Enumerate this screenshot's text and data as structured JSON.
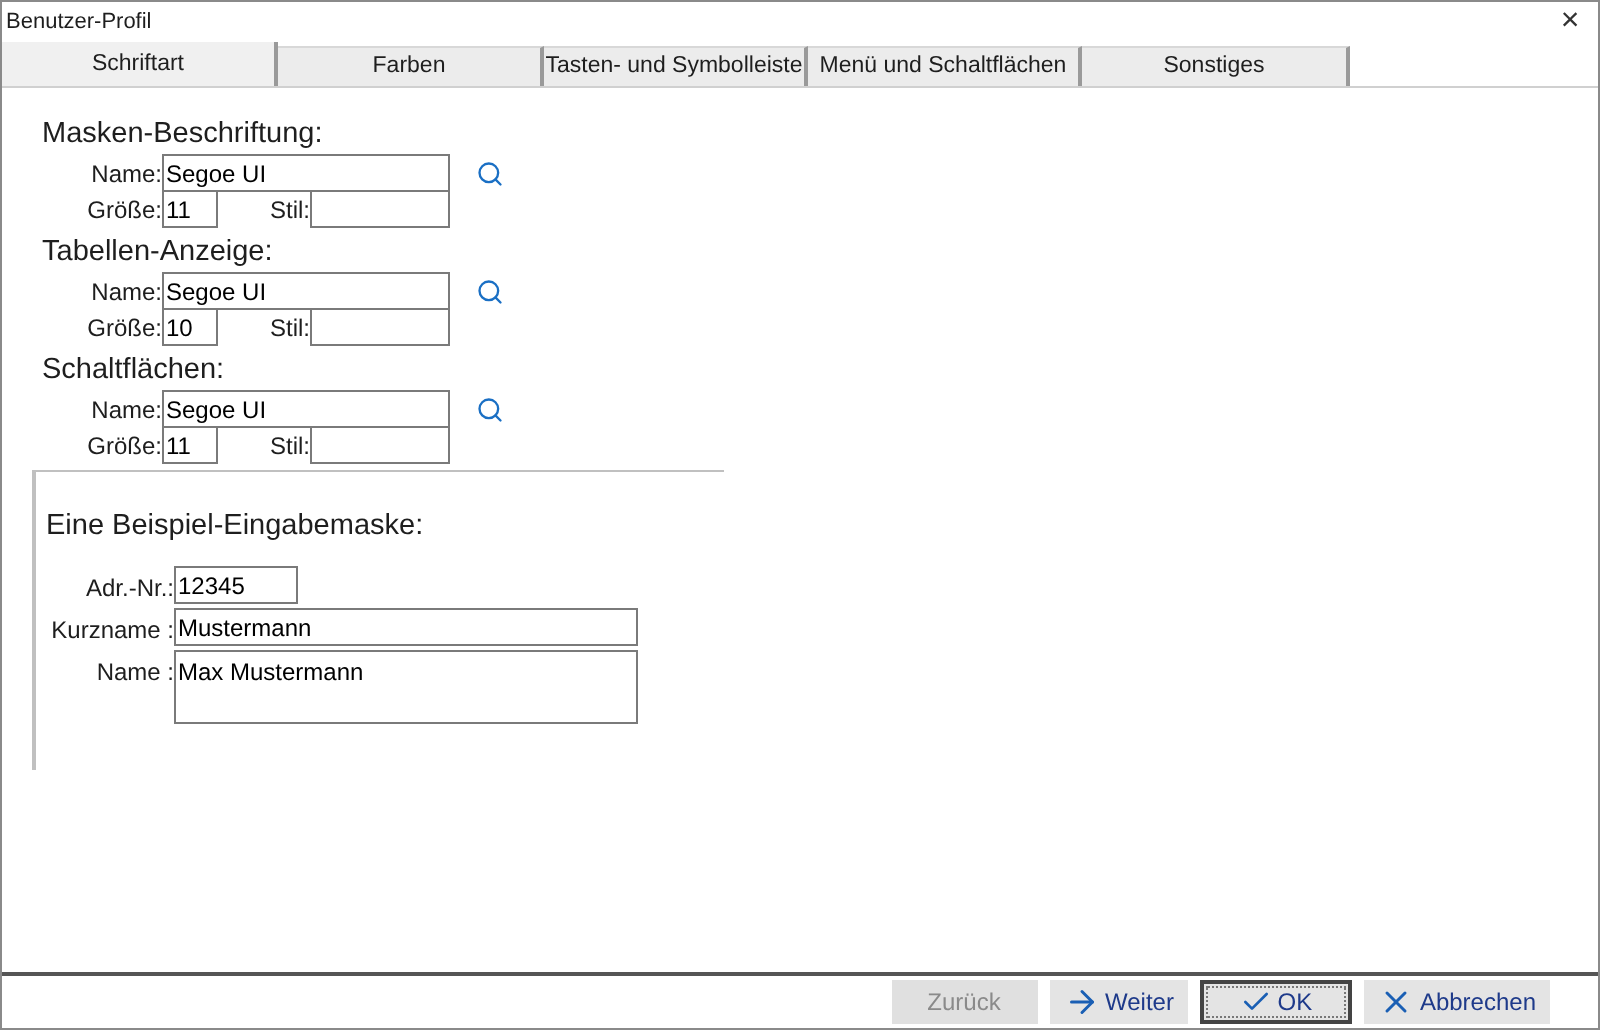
{
  "window": {
    "title": "Benutzer-Profil",
    "close": "×"
  },
  "tabs": [
    {
      "label": "Schriftart",
      "selected": true
    },
    {
      "label": "Farben",
      "selected": false
    },
    {
      "label": "Tasten- und Symbolleiste",
      "selected": false
    },
    {
      "label": "Menü und Schaltflächen",
      "selected": false
    },
    {
      "label": "Sonstiges",
      "selected": false
    }
  ],
  "font_sections": [
    {
      "heading": "Masken-Beschriftung:",
      "name_label": "Name:",
      "name": "Segoe UI",
      "size_label": "Größe:",
      "size": "11",
      "style_label": "Stil:"
    },
    {
      "heading": "Tabellen-Anzeige:",
      "name_label": "Name:",
      "name": "Segoe UI",
      "size_label": "Größe:",
      "size": "10",
      "style_label": "Stil:"
    },
    {
      "heading": "Schaltflächen:",
      "name_label": "Name:",
      "name": "Segoe UI",
      "size_label": "Größe:",
      "size": "11",
      "style_label": "Stil:"
    }
  ],
  "example": {
    "heading": "Eine Beispiel-Eingabemaske:",
    "fields": [
      {
        "label": "Adr.-Nr.:",
        "value": "12345",
        "kind": "short"
      },
      {
        "label": "Kurzname :",
        "value": "Mustermann",
        "kind": "line"
      },
      {
        "label": "Name :",
        "value": "Max Mustermann",
        "kind": "area"
      }
    ]
  },
  "buttons": [
    {
      "label": "Zurück",
      "kind": "back",
      "disabled": true,
      "default": false
    },
    {
      "label": "Weiter",
      "kind": "next",
      "disabled": false,
      "default": false
    },
    {
      "label": "OK",
      "kind": "ok",
      "disabled": false,
      "default": true
    },
    {
      "label": "Abbrechen",
      "kind": "cancel",
      "disabled": false,
      "default": false
    }
  ]
}
